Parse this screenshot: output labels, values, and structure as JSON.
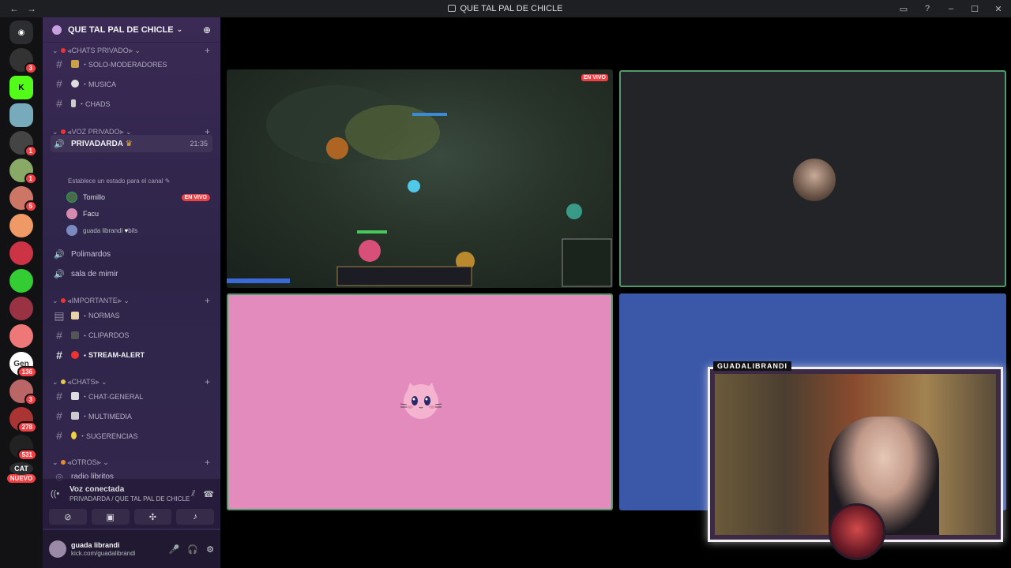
{
  "window": {
    "title": "QUE TAL PAL DE CHICLE"
  },
  "server_list": {
    "badges": [
      "3",
      "1",
      "1",
      "1",
      "5",
      "136",
      "3",
      "278",
      "531"
    ],
    "cat_label": "CAT",
    "new_label": "NUEVO"
  },
  "guild": {
    "name": "QUE TAL PAL DE CHICLE"
  },
  "categories": {
    "chats_privado": "CHATS PRIVADO",
    "voz_privado": "VOZ PRIVADO",
    "importante": "IMPORTANTE",
    "chats": "CHATS",
    "otros": "OTROS"
  },
  "channels": {
    "solo_moderadores": "・SOLO-MODERADORES",
    "musica": "・MUSICA",
    "chads": "・CHADS",
    "privadarda": "PRIVADARDA",
    "privadarda_time": "21:35",
    "privadarda_status": "Establece un estado para el canal",
    "polimardos": "Polimardos",
    "sala_de_mimir": "sala de mimir",
    "normas": "NORMAS",
    "clipardos": "CLIPARDOS",
    "stream_alert": "STREAM-ALERT",
    "chat_general": "・CHAT-GENERAL",
    "multimedia": "・MULTIMEDIA",
    "sugerencias": "・SUGERENCIAS",
    "radio_libritos": "radio libritos"
  },
  "voice_users": [
    {
      "name": "Tomillo",
      "badge": "EN VIVO"
    },
    {
      "name": "Facu"
    },
    {
      "name": "guada librandi",
      "extra": "bils"
    }
  ],
  "voice_connection": {
    "status": "Voz conectada",
    "location": "PRIVADARDA / QUE TAL PAL DE CHICLE"
  },
  "user": {
    "name": "guada librandi",
    "status": "kick.com/guadalibrandi"
  },
  "stage": {
    "live_badge": "EN VIVO",
    "overlay_label": "GUADALIBRANDI"
  },
  "colors": {
    "accent_live": "#f23f43",
    "speaking_border": "#4f9a6a",
    "pink_tile": "#e28bbc",
    "blue_tile": "#3b57a8"
  }
}
